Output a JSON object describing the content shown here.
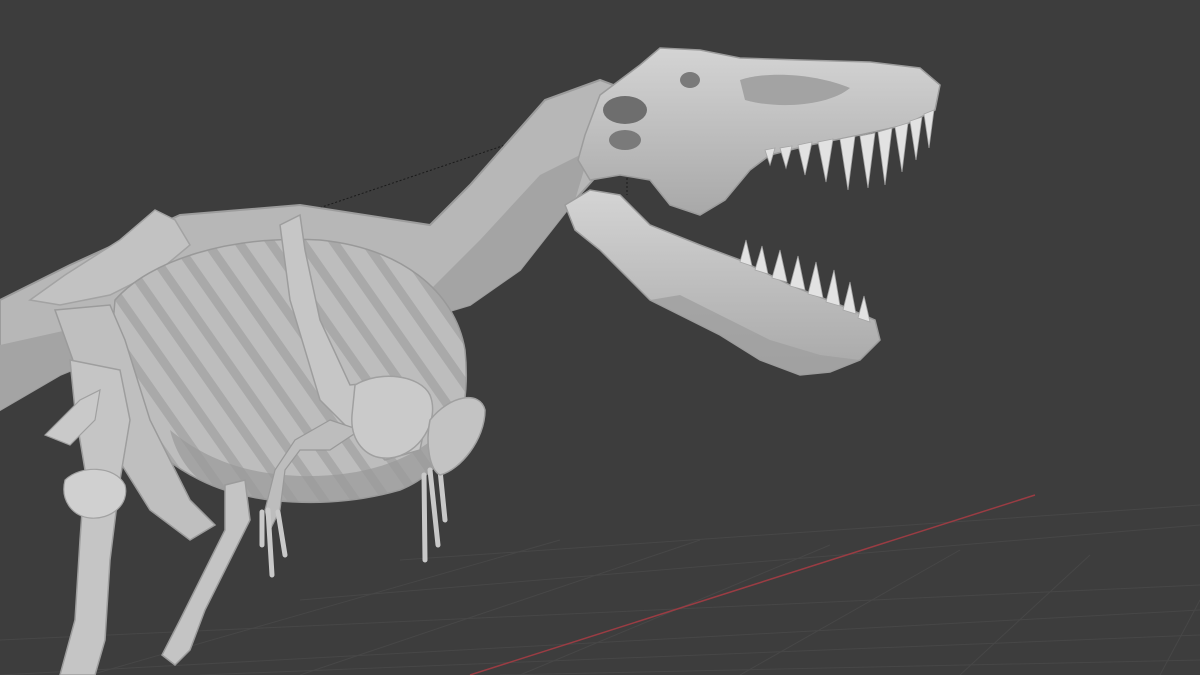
{
  "viewport": {
    "background": "#3d3d3d",
    "grid_color": "#474747",
    "x_axis_color": "#9a3c43",
    "model_color": "#c4c4c4",
    "model_shadow": "#8e8e8e",
    "model_highlight": "#d8d8d8",
    "cavity_color": "#5a5a5a"
  }
}
